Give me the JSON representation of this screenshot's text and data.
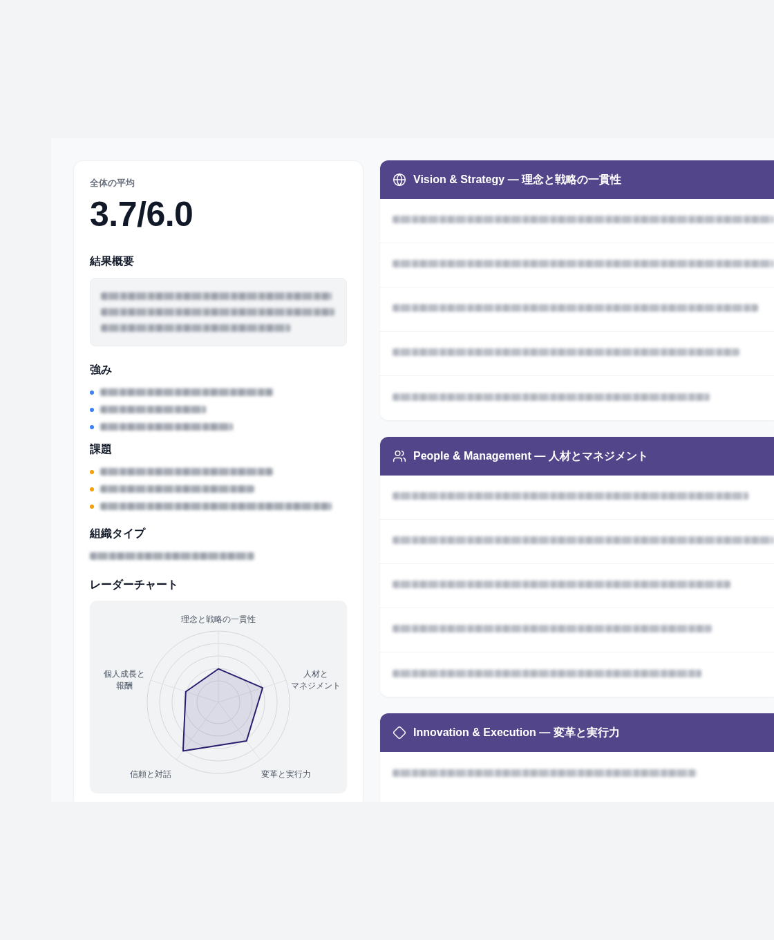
{
  "overall": {
    "label": "全体の平均",
    "score": "3.7/6.0"
  },
  "summary": {
    "title": "結果概要",
    "lines": [
      {
        "blurred": true
      },
      {
        "blurred": true
      },
      {
        "blurred": true
      }
    ]
  },
  "strengths": {
    "title": "強み",
    "items": [
      {
        "blurred": true
      },
      {
        "blurred": true
      },
      {
        "blurred": true
      }
    ]
  },
  "challenges": {
    "title": "課題",
    "items": [
      {
        "blurred": true
      },
      {
        "blurred": true
      },
      {
        "blurred": true
      }
    ]
  },
  "org_type": {
    "title": "組織タイプ",
    "value": {
      "blurred": true
    }
  },
  "radar": {
    "title": "レーダーチャート",
    "axes": [
      "理念と戦略の一貫性",
      "個人成長と報酬",
      "人材とマネジメント",
      "信頼と対話",
      "変革と実行力"
    ]
  },
  "sections": [
    {
      "title": "Vision & Strategy — 理念と戦略の一貫性",
      "questions": [
        {
          "blurred": true
        },
        {
          "blurred": true
        },
        {
          "blurred": true
        },
        {
          "blurred": true
        },
        {
          "blurred": true
        }
      ]
    },
    {
      "title": "People & Management — 人材とマネジメント",
      "questions": [
        {
          "blurred": true
        },
        {
          "blurred": true
        },
        {
          "blurred": true
        },
        {
          "blurred": true
        },
        {
          "blurred": true
        }
      ]
    },
    {
      "title": "Innovation & Execution — 変革と実行力",
      "questions": [
        {
          "blurred": true
        }
      ]
    }
  ]
}
